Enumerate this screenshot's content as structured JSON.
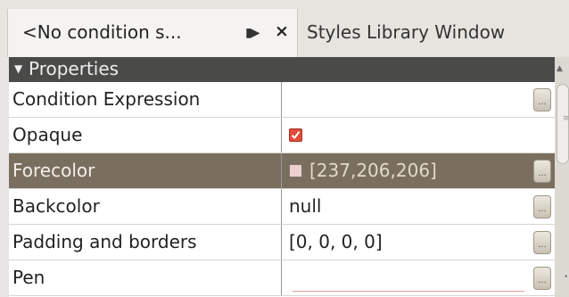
{
  "tabs": [
    {
      "title": "<No condition s...",
      "pin_icon": "pin-icon",
      "close_label": "×"
    },
    {
      "title": "Styles Library Window"
    }
  ],
  "properties": {
    "header": "Properties",
    "rows": [
      {
        "name": "Condition Expression",
        "value": ""
      },
      {
        "name": "Opaque",
        "value": "",
        "checked": true
      },
      {
        "name": "Forecolor",
        "value": "[237,206,206]",
        "color": "#edcece"
      },
      {
        "name": "Backcolor",
        "value": "null"
      },
      {
        "name": "Padding and borders",
        "value": "[0, 0, 0, 0]"
      },
      {
        "name": "Pen",
        "value": "",
        "line_color": "#e69a9a"
      }
    ],
    "dots_label": "..."
  },
  "colors": {
    "selected_row": "#7a6f5f",
    "header_bg": "#4a4a48",
    "checkbox": "#e24b3a"
  }
}
